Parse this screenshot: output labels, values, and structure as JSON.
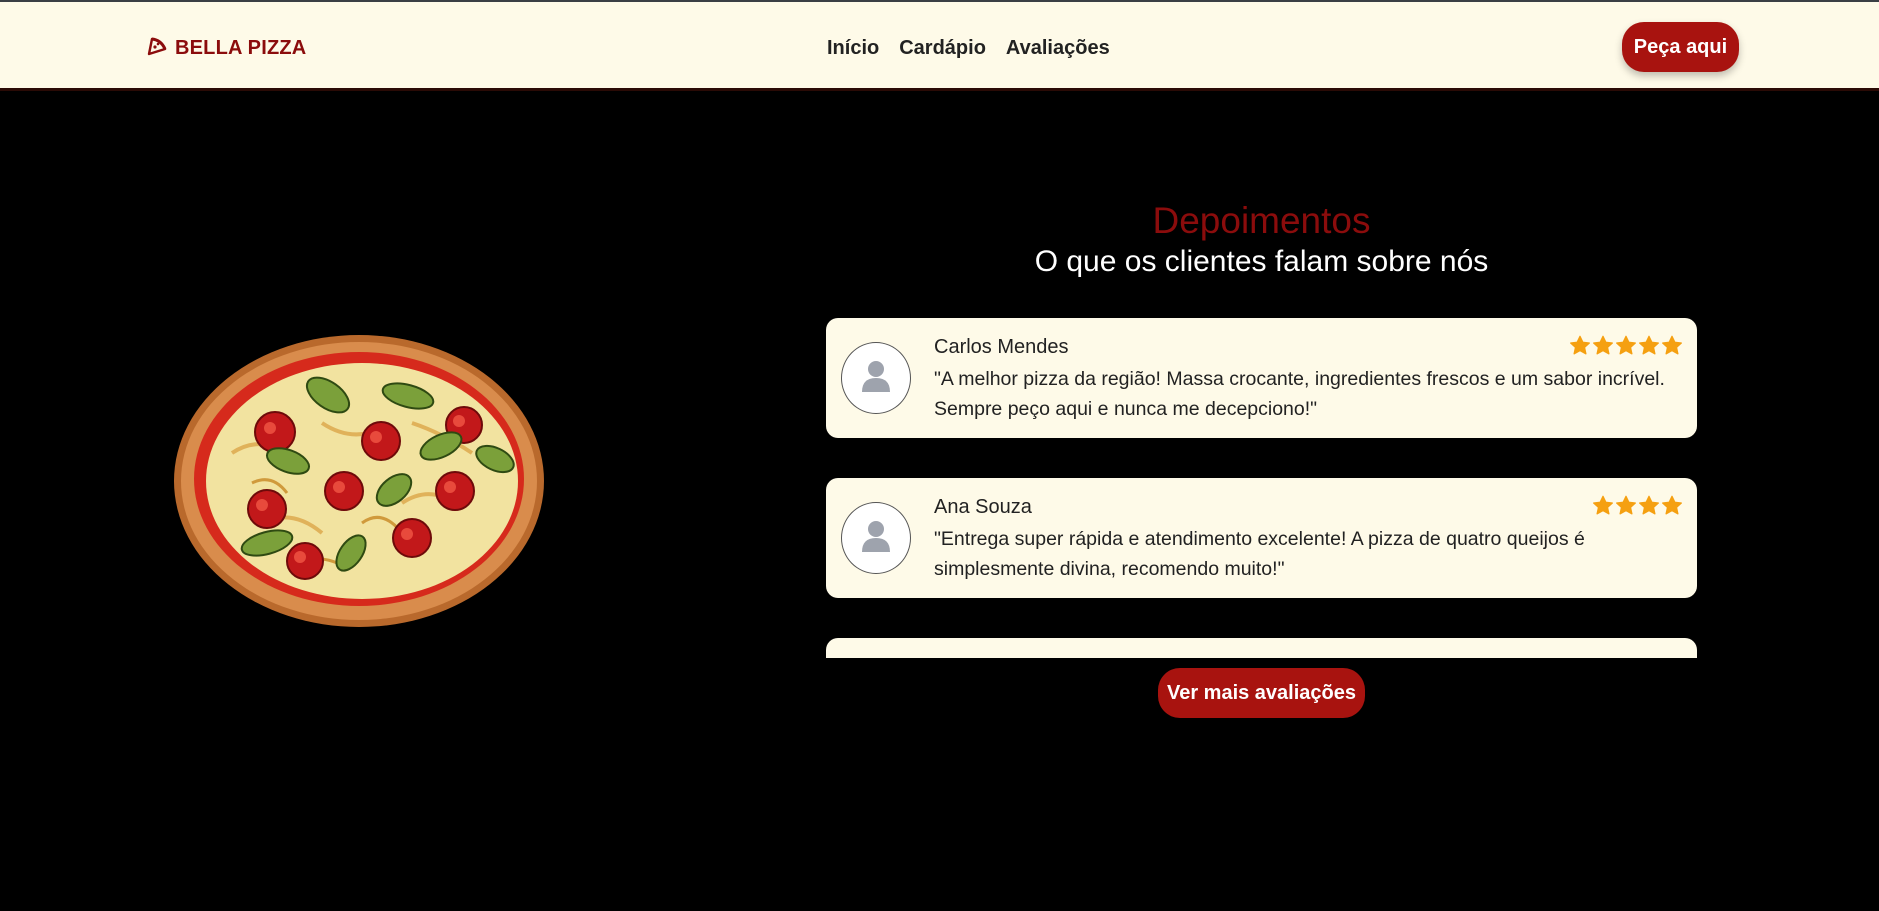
{
  "header": {
    "brand": "BELLA PIZZA",
    "nav": [
      "Início",
      "Cardápio",
      "Avaliações"
    ],
    "cta_label": "Peça aqui"
  },
  "testimonials": {
    "title": "Depoimentos",
    "subtitle": "O que os clientes falam sobre nós",
    "reviews": [
      {
        "name": "Carlos Mendes",
        "rating": 5,
        "text": "\"A melhor pizza da região! Massa crocante, ingredientes frescos e um sabor incrível. Sempre peço aqui e nunca me decepciono!\""
      },
      {
        "name": "Ana Souza",
        "rating": 4,
        "text": "\"Entrega super rápida e atendimento excelente! A pizza de quatro queijos é simplesmente divina, recomendo muito!\""
      }
    ],
    "more_label": "Ver mais avaliações"
  },
  "colors": {
    "brand_red": "#8b0c0c",
    "button_red": "#a8130f",
    "cream": "#fefae8",
    "star": "#f5a011"
  }
}
